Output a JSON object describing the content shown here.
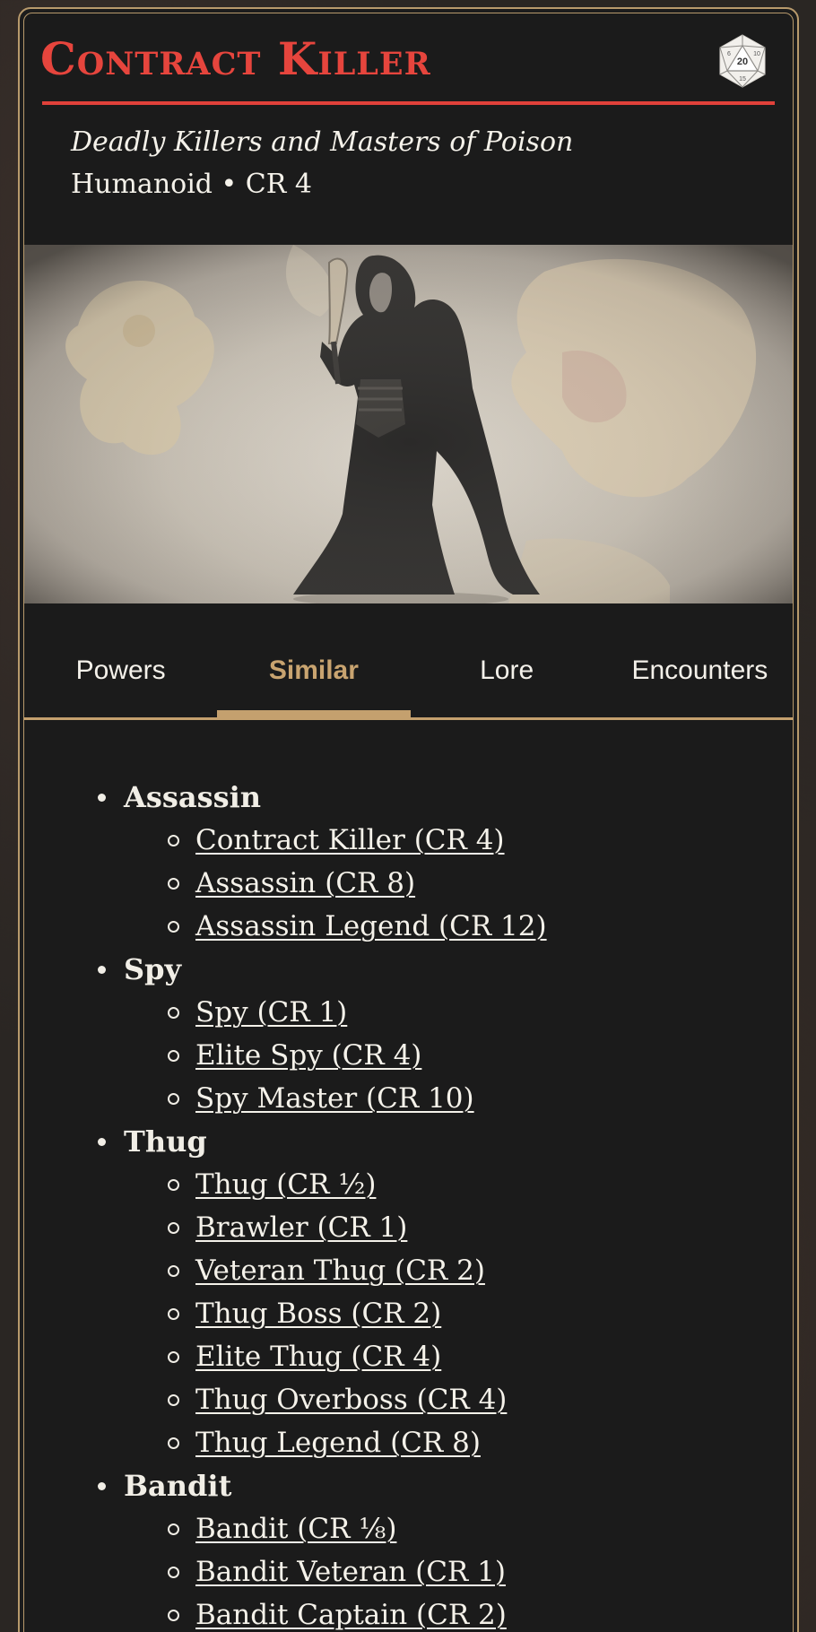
{
  "header": {
    "title": "Contract Killer",
    "subtitle": "Deadly Killers and Masters of Poison",
    "type_line": "Humanoid • CR 4",
    "dice_icon": "d20-icon"
  },
  "tabs": [
    {
      "label": "Powers",
      "active": false
    },
    {
      "label": "Similar",
      "active": true
    },
    {
      "label": "Lore",
      "active": false
    },
    {
      "label": "Encounters",
      "active": false
    }
  ],
  "similar": {
    "groups": [
      {
        "name": "Assassin",
        "items": [
          "Contract Killer (CR 4)",
          "Assassin (CR 8)",
          "Assassin Legend (CR 12)"
        ]
      },
      {
        "name": "Spy",
        "items": [
          "Spy (CR 1)",
          "Elite Spy (CR 4)",
          "Spy Master (CR 10)"
        ]
      },
      {
        "name": "Thug",
        "items": [
          "Thug (CR ½)",
          "Brawler (CR 1)",
          "Veteran Thug (CR 2)",
          "Thug Boss (CR 2)",
          "Elite Thug (CR 4)",
          "Thug Overboss (CR 4)",
          "Thug Legend (CR 8)"
        ]
      },
      {
        "name": "Bandit",
        "items": [
          "Bandit (CR ⅛)",
          "Bandit Veteran (CR 1)",
          "Bandit Captain (CR 2)"
        ]
      }
    ]
  },
  "colors": {
    "accent_red": "#e6453d",
    "accent_gold": "#c4a06e",
    "background": "#1b1b1b"
  }
}
